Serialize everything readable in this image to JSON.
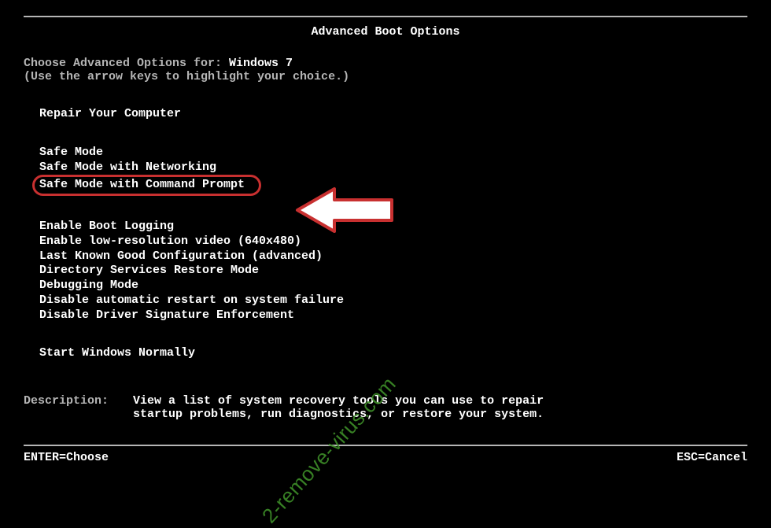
{
  "title": "Advanced Boot Options",
  "prompt": {
    "label": "Choose Advanced Options for: ",
    "os": "Windows 7",
    "hint": "(Use the arrow keys to highlight your choice.)"
  },
  "options": {
    "group1": [
      "Repair Your Computer"
    ],
    "group2": [
      "Safe Mode",
      "Safe Mode with Networking",
      "Safe Mode with Command Prompt"
    ],
    "group3": [
      "Enable Boot Logging",
      "Enable low-resolution video (640x480)",
      "Last Known Good Configuration (advanced)",
      "Directory Services Restore Mode",
      "Debugging Mode",
      "Disable automatic restart on system failure",
      "Disable Driver Signature Enforcement"
    ],
    "group4": [
      "Start Windows Normally"
    ]
  },
  "description": {
    "label": "Description:",
    "text": "View a list of system recovery tools you can use to repair startup problems, run diagnostics, or restore your system."
  },
  "footer": {
    "left": "ENTER=Choose",
    "right": "ESC=Cancel"
  },
  "watermark": "2-remove-virus.com",
  "highlighted_index": 2
}
